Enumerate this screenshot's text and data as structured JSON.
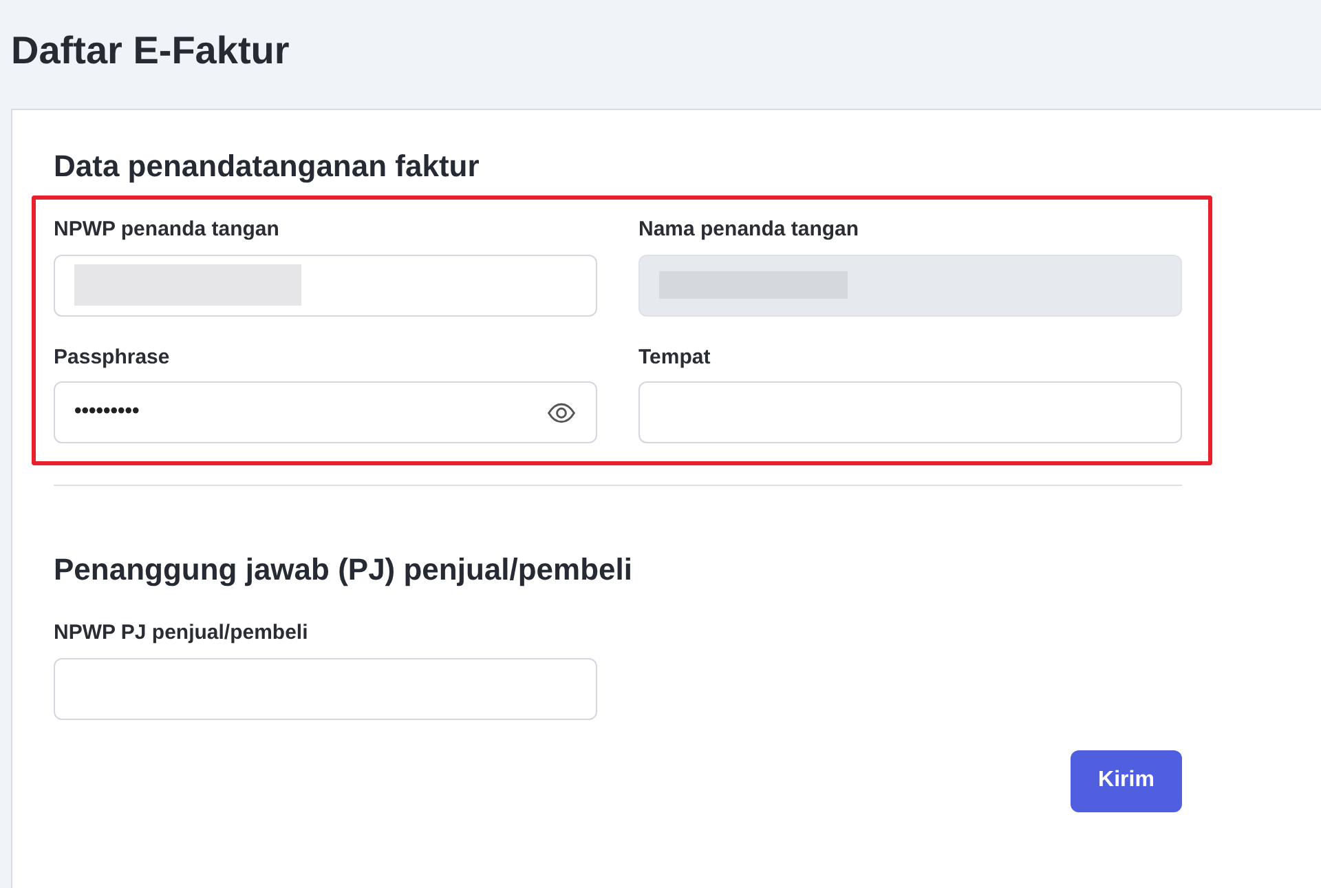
{
  "page": {
    "title": "Daftar E-Faktur"
  },
  "sections": [
    {
      "heading": "Data penandatanganan faktur",
      "highlighted": true,
      "fields": [
        {
          "label": "NPWP penanda tangan",
          "kind": "text",
          "redacted": true,
          "disabled": false
        },
        {
          "label": "Nama penanda tangan",
          "kind": "text",
          "redacted": true,
          "disabled": true
        },
        {
          "label": "Passphrase",
          "kind": "password",
          "value": "•••••••••",
          "redacted": false,
          "disabled": false
        },
        {
          "label": "Tempat",
          "kind": "text",
          "redacted": false,
          "disabled": false
        }
      ]
    },
    {
      "heading": "Penanggung jawab (PJ) penjual/pembeli",
      "highlighted": false,
      "fields": [
        {
          "label": "NPWP PJ penjual/pembeli",
          "kind": "text",
          "redacted": false,
          "disabled": false
        }
      ]
    }
  ],
  "submit": {
    "label": "Kirim"
  }
}
